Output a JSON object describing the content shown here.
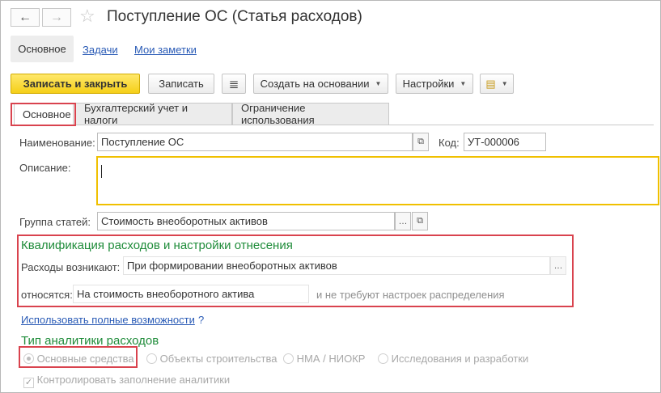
{
  "window": {
    "title": "Поступление ОС (Статья расходов)",
    "back_icon": "←",
    "forward_icon": "→",
    "favorite_icon": "☆"
  },
  "nav": {
    "main": "Основное",
    "tasks": "Задачи",
    "notes": "Мои заметки"
  },
  "toolbar": {
    "save_close": "Записать и закрыть",
    "save": "Записать",
    "list_icon": "≣",
    "create_based": "Создать на основании",
    "settings": "Настройки",
    "report_icon": "▤"
  },
  "tabs": [
    {
      "label": "Основное"
    },
    {
      "label": "Бухгалтерский учет и налоги"
    },
    {
      "label": "Ограничение использования"
    }
  ],
  "form": {
    "name_label": "Наименование:",
    "name_value": "Поступление ОС",
    "code_label": "Код:",
    "code_value": "УТ-000006",
    "description_label": "Описание:",
    "description_value": "",
    "group_label": "Группа статей:",
    "group_value": "Стоимость внеоборотных активов",
    "qualification_title": "Квалификация расходов и настройки отнесения",
    "arise_label": "Расходы возникают:",
    "arise_value": "При формировании внеоборотных активов",
    "relate_label": "относятся:",
    "relate_value": "На стоимость внеоборотного актива",
    "relate_note": "и не требуют настроек распределения",
    "full_features_link": "Использовать полные возможности",
    "help": "?",
    "analytics_title": "Тип аналитики расходов",
    "analytics_options": [
      {
        "label": "Основные средства",
        "selected": true
      },
      {
        "label": "Объекты строительства",
        "selected": false
      },
      {
        "label": "НМА / НИОКР",
        "selected": false
      },
      {
        "label": "Исследования и разработки",
        "selected": false
      }
    ],
    "control_label": "Контролировать заполнение аналитики",
    "control_checked": true
  },
  "colors": {
    "accent_green": "#1f8c3a",
    "highlight_red": "#d9434e",
    "primary_button": "#f5cf18",
    "focus_border": "#f0c000"
  }
}
